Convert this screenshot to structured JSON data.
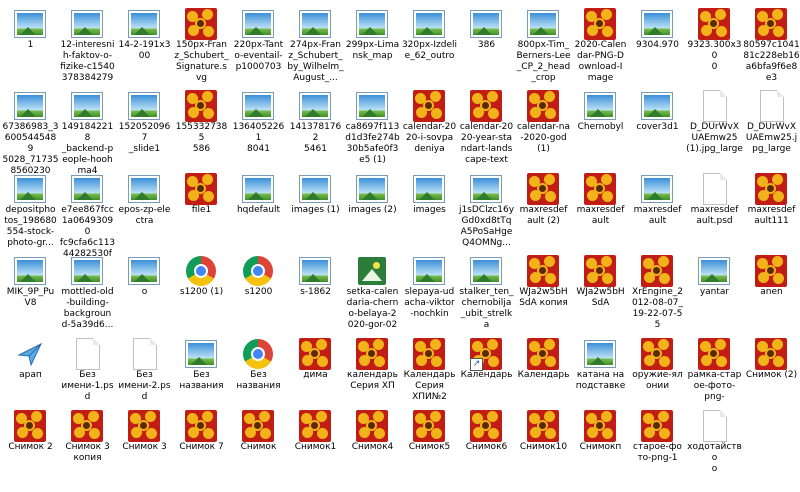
{
  "desktop": {
    "items": [
      {
        "label": "1",
        "icon": "photo-icon",
        "col": 0,
        "row": 0
      },
      {
        "label": "12-interesni\nh-faktov-o-\nfizike-c1540\n378384279",
        "icon": "photo-icon",
        "col": 1,
        "row": 0
      },
      {
        "label": "14-2-191x3\n00",
        "icon": "photo-icon",
        "col": 2,
        "row": 0
      },
      {
        "label": "150px-Fran\nz_Schubert_\nSignature.s\nvg",
        "icon": "flower-icon",
        "col": 3,
        "row": 0
      },
      {
        "label": "220px-Tant\no-eventail-\np1000703",
        "icon": "photo-icon",
        "col": 4,
        "row": 0
      },
      {
        "label": "274px-Fran\nz_Schubert_\nby_Wilhelm_\nAugust_...",
        "icon": "photo-icon",
        "col": 5,
        "row": 0
      },
      {
        "label": "299px-Lima\nnsk_map",
        "icon": "photo-icon",
        "col": 6,
        "row": 0
      },
      {
        "label": "320px-Izdeli\ne_62_outro",
        "icon": "photo-icon",
        "col": 7,
        "row": 0
      },
      {
        "label": "386",
        "icon": "photo-icon",
        "col": 8,
        "row": 0
      },
      {
        "label": "800px-Tim_\nBerners-Lee\n_CP_2_head\n_crop",
        "icon": "photo-icon",
        "col": 9,
        "row": 0
      },
      {
        "label": "2020-Calen\ndar-PNG-D\nownload-I\nmage",
        "icon": "flower-icon",
        "col": 10,
        "row": 0
      },
      {
        "label": "9304.970",
        "icon": "photo-icon",
        "col": 11,
        "row": 0
      },
      {
        "label": "9323.300x30\n0",
        "icon": "flower-icon",
        "col": 12,
        "row": 0
      },
      {
        "label": "80597c1041\n81c228eb16\na6bfa9f6e8\ne3",
        "icon": "flower-icon",
        "col": 13,
        "row": 0
      },
      {
        "label": "67386983_3\n6005445489\n5028_71735\n8560230 8...",
        "icon": "photo-icon",
        "col": 0,
        "row": 1
      },
      {
        "label": "1491842218\n_backend-p\neople-hooh\nma4",
        "icon": "photo-icon",
        "col": 1,
        "row": 1
      },
      {
        "label": "1520520967\n_slide1",
        "icon": "photo-icon",
        "col": 2,
        "row": 1
      },
      {
        "label": "1553327385\n586",
        "icon": "flower-icon",
        "col": 3,
        "row": 1
      },
      {
        "label": "1364052261\n8041",
        "icon": "photo-icon",
        "col": 4,
        "row": 1
      },
      {
        "label": "1413781762\n5461",
        "icon": "photo-icon",
        "col": 5,
        "row": 1
      },
      {
        "label": "ca8697f113\nd1d3fe274b\n30b5afe0f3\ne5 (1)",
        "icon": "photo-icon",
        "col": 6,
        "row": 1
      },
      {
        "label": "calendar-20\n20-i-sovpa\ndeniya",
        "icon": "flower-icon",
        "col": 7,
        "row": 1
      },
      {
        "label": "calendar-20\n20-year-sta\nndart-lands\ncape-text",
        "icon": "flower-icon",
        "col": 8,
        "row": 1
      },
      {
        "label": "calendar-na\n-2020-god\n(1)",
        "icon": "flower-icon",
        "col": 9,
        "row": 1
      },
      {
        "label": "Chernobyl",
        "icon": "photo-icon",
        "col": 10,
        "row": 1
      },
      {
        "label": "cover3d1",
        "icon": "photo-icon",
        "col": 11,
        "row": 1
      },
      {
        "label": "D_DUrWvX\nUAEmw25\n(1).jpg_large",
        "icon": "doc-icon",
        "col": 12,
        "row": 1
      },
      {
        "label": "D_DUrWvX\nUAEmw25.j\npg_large",
        "icon": "doc-icon",
        "col": 13,
        "row": 1
      },
      {
        "label": "depositpho\ntos_198680\n554-stock-\nphoto-gr...",
        "icon": "photo-icon",
        "col": 0,
        "row": 2
      },
      {
        "label": "e7ee867fcc\n1a06493090\nfc9cfa6c113\n44282530f",
        "icon": "photo-icon",
        "col": 1,
        "row": 2
      },
      {
        "label": "epos-zp-ele\nctra",
        "icon": "photo-icon",
        "col": 2,
        "row": 2
      },
      {
        "label": "file1",
        "icon": "flower-icon",
        "col": 3,
        "row": 2
      },
      {
        "label": "hqdefault",
        "icon": "photo-icon",
        "col": 4,
        "row": 2
      },
      {
        "label": "images (1)",
        "icon": "photo-icon",
        "col": 5,
        "row": 2
      },
      {
        "label": "images (2)",
        "icon": "photo-icon",
        "col": 6,
        "row": 2
      },
      {
        "label": "images",
        "icon": "photo-icon",
        "col": 7,
        "row": 2
      },
      {
        "label": "j1sDClzc16y\nGd0xd8tTq\nA5PoSaHge\nQ4OMNg...",
        "icon": "photo-icon",
        "col": 8,
        "row": 2
      },
      {
        "label": "maxresdef\nault (2)",
        "icon": "flower-icon",
        "col": 9,
        "row": 2
      },
      {
        "label": "maxresdef\nault",
        "icon": "flower-icon",
        "col": 10,
        "row": 2
      },
      {
        "label": "maxresdef\nault",
        "icon": "photo-icon",
        "col": 11,
        "row": 2
      },
      {
        "label": "maxresdef\nault.psd",
        "icon": "doc-icon",
        "col": 12,
        "row": 2
      },
      {
        "label": "maxresdef\nault111",
        "icon": "flower-icon",
        "col": 13,
        "row": 2
      },
      {
        "label": "MIK_9P_Pu\nV8",
        "icon": "photo-icon",
        "col": 0,
        "row": 3
      },
      {
        "label": "mottled-old\n-building-\nbackgroun\nd-5a39d6...",
        "icon": "photo-icon",
        "col": 1,
        "row": 3
      },
      {
        "label": "o",
        "icon": "photo-icon",
        "col": 2,
        "row": 3
      },
      {
        "label": "s1200 (1)",
        "icon": "chrome-icon",
        "col": 3,
        "row": 3
      },
      {
        "label": "s1200",
        "icon": "chrome-icon",
        "col": 4,
        "row": 3
      },
      {
        "label": "s-1862",
        "icon": "photo-icon",
        "col": 5,
        "row": 3
      },
      {
        "label": "setka-calen\ndaria-chern\no-belaya-2\n020-gor-02",
        "icon": "calendar-icon",
        "col": 6,
        "row": 3
      },
      {
        "label": "slepaya-ud\nacha-viktor\n-nochkin",
        "icon": "photo-icon",
        "col": 7,
        "row": 3
      },
      {
        "label": "stalker_ten_\nchernobilja\n_ubit_strelk\na",
        "icon": "photo-icon",
        "col": 8,
        "row": 3
      },
      {
        "label": "WJa2w5bH\nSdA копия",
        "icon": "flower-icon",
        "col": 9,
        "row": 3
      },
      {
        "label": "WJa2w5bH\nSdA",
        "icon": "flower-icon",
        "col": 10,
        "row": 3
      },
      {
        "label": "XrEngine_2\n012-08-07_\n19-22-07-5\n5",
        "icon": "flower-icon",
        "col": 11,
        "row": 3
      },
      {
        "label": "yantar",
        "icon": "photo-icon",
        "col": 12,
        "row": 3
      },
      {
        "label": "anen",
        "icon": "flower-icon",
        "col": 13,
        "row": 3
      },
      {
        "label": "арап",
        "icon": "plane-icon",
        "col": 0,
        "row": 4
      },
      {
        "label": "Без\nимени-1.ps\nd",
        "icon": "doc-icon",
        "col": 1,
        "row": 4
      },
      {
        "label": "Без\nимени-2.ps\nd",
        "icon": "doc-icon",
        "col": 2,
        "row": 4
      },
      {
        "label": "Без\nназвания",
        "icon": "photo-icon",
        "col": 3,
        "row": 4
      },
      {
        "label": "Без\nназвания",
        "icon": "chrome-icon",
        "col": 4,
        "row": 4
      },
      {
        "label": "дима",
        "icon": "flower-icon",
        "col": 5,
        "row": 4
      },
      {
        "label": "календарь\nСерия ХП",
        "icon": "flower-icon",
        "col": 6,
        "row": 4
      },
      {
        "label": "Календарь\nСерия\nХПИ№2",
        "icon": "flower-icon",
        "col": 7,
        "row": 4
      },
      {
        "label": "Календарь",
        "icon": "flower-icon",
        "col": 8,
        "row": 4,
        "shortcut": true
      },
      {
        "label": "Календарь",
        "icon": "flower-icon",
        "col": 9,
        "row": 4
      },
      {
        "label": "катана на\nподставке",
        "icon": "photo-icon",
        "col": 10,
        "row": 4
      },
      {
        "label": "оружие-ял\nонии",
        "icon": "flower-icon",
        "col": 11,
        "row": 4
      },
      {
        "label": "рамка-старое-фото-\npng-",
        "icon": "flower-icon",
        "col": 12,
        "row": 4
      },
      {
        "label": "Снимок (2)",
        "icon": "flower-icon",
        "col": 13,
        "row": 4
      },
      {
        "label": "Снимок 2",
        "icon": "flower-icon",
        "col": 0,
        "row": 5
      },
      {
        "label": "Снимок 3\nкопия",
        "icon": "flower-icon",
        "col": 1,
        "row": 5
      },
      {
        "label": "Снимок 3",
        "icon": "flower-icon",
        "col": 2,
        "row": 5
      },
      {
        "label": "Снимок 7",
        "icon": "flower-icon",
        "col": 3,
        "row": 5
      },
      {
        "label": "Снимок",
        "icon": "flower-icon",
        "col": 4,
        "row": 5
      },
      {
        "label": "Снимок1",
        "icon": "flower-icon",
        "col": 5,
        "row": 5
      },
      {
        "label": "Снимок4",
        "icon": "flower-icon",
        "col": 6,
        "row": 5
      },
      {
        "label": "Снимок5",
        "icon": "flower-icon",
        "col": 7,
        "row": 5
      },
      {
        "label": "Снимок6",
        "icon": "flower-icon",
        "col": 8,
        "row": 5
      },
      {
        "label": "Снимок10",
        "icon": "flower-icon",
        "col": 9,
        "row": 5
      },
      {
        "label": "Снимокп",
        "icon": "flower-icon",
        "col": 10,
        "row": 5
      },
      {
        "label": "старое-фо\nто-png-1",
        "icon": "flower-icon",
        "col": 11,
        "row": 5
      },
      {
        "label": "ходотайство\nо",
        "icon": "doc-icon",
        "col": 12,
        "row": 5
      }
    ]
  }
}
